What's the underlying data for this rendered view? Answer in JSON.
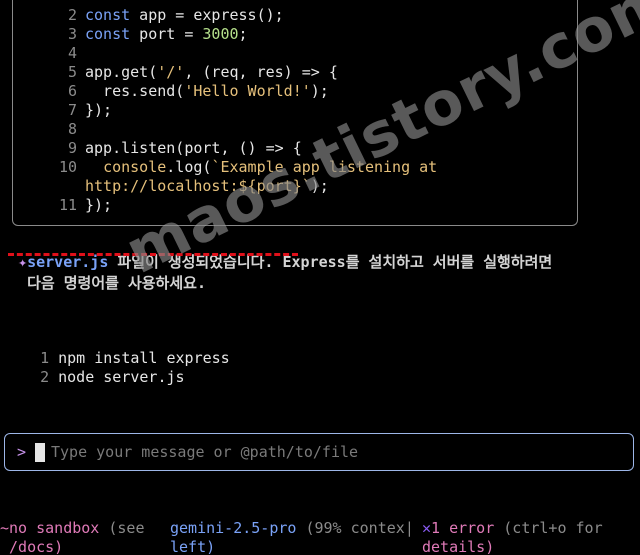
{
  "code_block": {
    "lines": [
      {
        "num": "2",
        "parts": [
          [
            "kw",
            "const"
          ],
          [
            "t",
            " app = express();"
          ]
        ]
      },
      {
        "num": "3",
        "parts": [
          [
            "kw",
            "const"
          ],
          [
            "t",
            " port = "
          ],
          [
            "num",
            "3000"
          ],
          [
            "t",
            ";"
          ]
        ]
      },
      {
        "num": "4",
        "parts": []
      },
      {
        "num": "5",
        "parts": [
          [
            "t",
            "app.get("
          ],
          [
            "str",
            "'/'"
          ],
          [
            "t",
            ", (req, res) => {"
          ]
        ]
      },
      {
        "num": "6",
        "parts": [
          [
            "t",
            "  res.send("
          ],
          [
            "str",
            "'Hello World!'"
          ],
          [
            "t",
            ");"
          ]
        ]
      },
      {
        "num": "7",
        "parts": [
          [
            "t",
            "});"
          ]
        ]
      },
      {
        "num": "8",
        "parts": []
      },
      {
        "num": "9",
        "parts": [
          [
            "t",
            "app.listen(port, () => {"
          ]
        ]
      },
      {
        "num": "10",
        "parts": [
          [
            "t",
            "  "
          ],
          [
            "fn",
            "console"
          ],
          [
            "t",
            ".log("
          ],
          [
            "str",
            "`Example app listening at"
          ]
        ]
      },
      {
        "num": "",
        "parts": [
          [
            "str",
            "http://localhost:${port}`"
          ],
          [
            "t",
            ");"
          ]
        ]
      },
      {
        "num": "11",
        "parts": [
          [
            "t",
            "});"
          ]
        ]
      }
    ]
  },
  "assistant_message": {
    "sparkle": "✦",
    "file_name": "server.js",
    "line1_rest": " 파일이 생성되었습니다. Express를 설치하고 서버를 실행하려면",
    "line2": " 다음 명령어를 사용하세요."
  },
  "commands": [
    {
      "num": "1",
      "text": "npm install express"
    },
    {
      "num": "2",
      "text": "node server.js"
    }
  ],
  "input": {
    "prompt": ">",
    "placeholder": "Type your message or @path/to/file",
    "value": ""
  },
  "footer": {
    "sandbox_main": "~no sandbox",
    "sandbox_hint1": " (see",
    "sandbox_hint2": " /docs)",
    "model_name": "gemini-2.5-pro",
    "context_1": " (99% contex",
    "context_sep": "|",
    "context_2": "left)",
    "error_icon": "✕",
    "error_count": "1 error",
    "error_hint1": " (ctrl+o for",
    "error_hint2": "details)"
  },
  "watermark": "maos.tistory.com",
  "colors": {
    "keyword": "#7aa2f7",
    "number": "#b5e08b",
    "string": "#e5c07b",
    "accent_pink": "#e07ab8",
    "accent_purple": "#c792ea",
    "input_border": "#9db6e8",
    "underline_red": "#e0101a"
  }
}
